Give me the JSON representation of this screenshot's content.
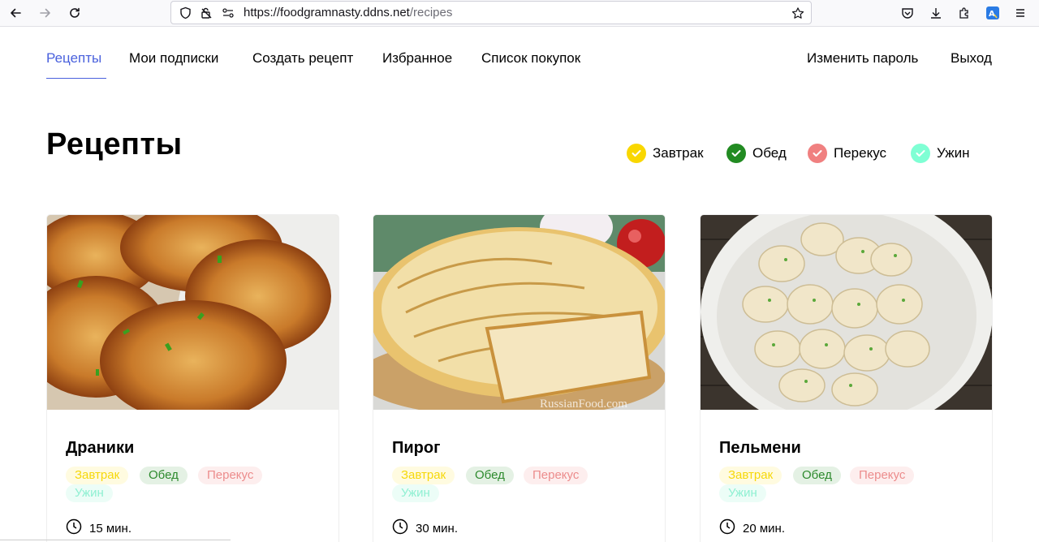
{
  "browser": {
    "url_host": "https://foodgramnasty.ddns.net",
    "url_path": "/recipes"
  },
  "nav": {
    "recipes": "Рецепты",
    "subscriptions": "Мои подписки",
    "create": "Создать рецепт",
    "favorites": "Избранное",
    "shopping": "Список покупок",
    "change_password": "Изменить пароль",
    "logout": "Выход"
  },
  "page": {
    "title": "Рецепты"
  },
  "filters": [
    {
      "label": "Завтрак",
      "color": "#f9d700"
    },
    {
      "label": "Обед",
      "color": "#228b22"
    },
    {
      "label": "Перекус",
      "color": "#f08080"
    },
    {
      "label": "Ужин",
      "color": "#7fffd4"
    }
  ],
  "tag_styles": {
    "breakfast": {
      "bg": "#fffbe0",
      "fg": "#f6d80a"
    },
    "lunch": {
      "bg": "#e4f1e4",
      "fg": "#2d8a2d"
    },
    "snack": {
      "bg": "#fdeeee",
      "fg": "#ec8c8c"
    },
    "dinner": {
      "bg": "#ecfdf7",
      "fg": "#8ff0d2"
    }
  },
  "recipes": [
    {
      "name": "Драники",
      "tags": [
        "Завтрак",
        "Обед",
        "Перекус",
        "Ужин"
      ],
      "time": "15 мин."
    },
    {
      "name": "Пирог",
      "tags": [
        "Завтрак",
        "Обед",
        "Перекус",
        "Ужин"
      ],
      "time": "30 мин."
    },
    {
      "name": "Пельмени",
      "tags": [
        "Завтрак",
        "Обед",
        "Перекус",
        "Ужин"
      ],
      "time": "20 мин."
    }
  ],
  "watermark": "RussianFood.com"
}
